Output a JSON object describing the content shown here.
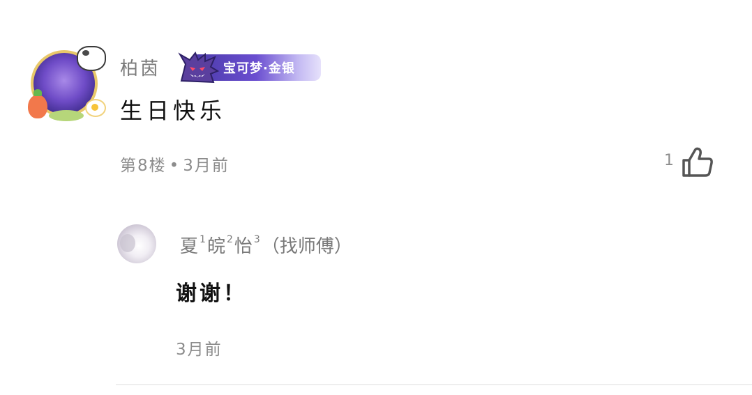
{
  "comment": {
    "username": "柏茵",
    "badge_text": "宝可梦·金银",
    "content": "生日快乐",
    "floor": "第8楼",
    "separator": "•",
    "time": "3月前",
    "like_count": "1"
  },
  "reply": {
    "username_parts": [
      "夏",
      "1",
      "皖",
      "2",
      "怡",
      "3",
      "（找师傅）"
    ],
    "content": "谢谢！",
    "time": "3月前"
  },
  "icons": {
    "like": "thumbs-up-icon"
  }
}
